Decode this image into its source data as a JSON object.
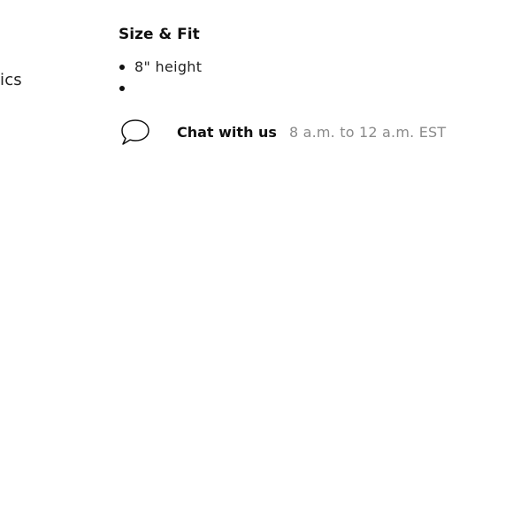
{
  "left_partial_text": "ics",
  "size_fit": {
    "title": "Size & Fit",
    "bullets": [
      "8\" height",
      ""
    ]
  },
  "chat": {
    "icon": "chat-bubble-icon",
    "label": "Chat with us",
    "hours": "8 a.m. to 12 a.m. EST"
  }
}
